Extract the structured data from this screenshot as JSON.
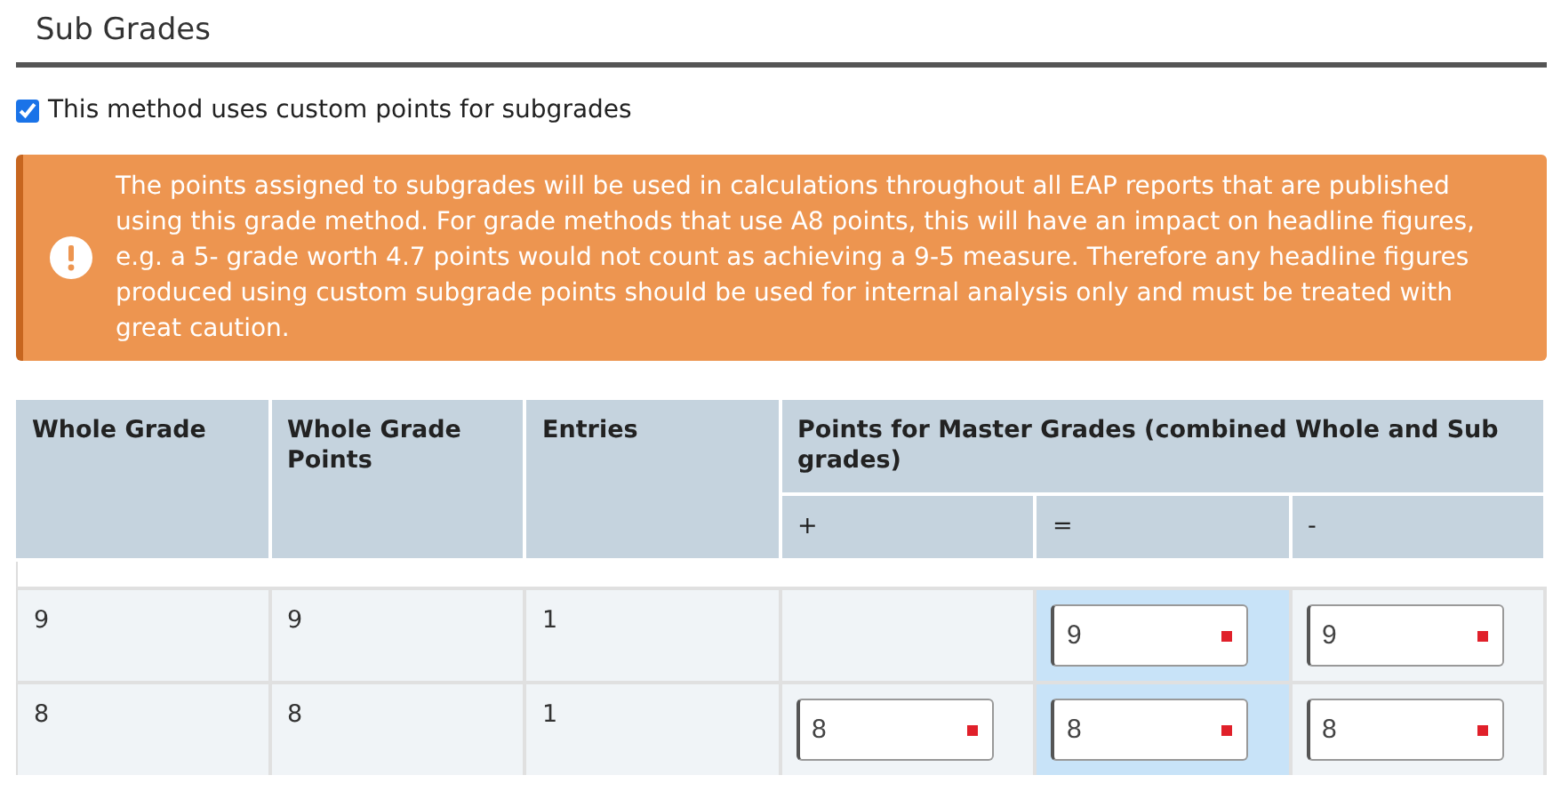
{
  "section": {
    "title": "Sub Grades"
  },
  "custom_points": {
    "label": "This method uses custom points for subgrades",
    "checked": true
  },
  "warning": {
    "text": "The points assigned to subgrades will be used in calculations throughout all EAP reports that are published using this grade method. For grade methods that use A8 points, this will have an impact on headline figures, e.g. a 5- grade worth 4.7 points would not count as achieving a 9-5 measure. Therefore any headline figures produced using custom subgrade points should be used for internal analysis only and must be treated with great caution."
  },
  "table": {
    "columns": [
      "Whole Grade",
      "Whole Grade Points",
      "Entries"
    ],
    "group_heading": "Points for Master Grades (combined Whole and Sub grades)",
    "sub_columns": [
      {
        "label": "+",
        "highlighted": false
      },
      {
        "label": "=",
        "highlighted": true
      },
      {
        "label": "-",
        "highlighted": false
      }
    ],
    "rows": [
      {
        "cells": [
          "9",
          "9",
          "1"
        ],
        "points": [
          {
            "kind": "empty"
          },
          {
            "kind": "input",
            "value": "9",
            "required": true
          },
          {
            "kind": "input",
            "value": "9",
            "required": true
          }
        ]
      },
      {
        "cells": [
          "8",
          "8",
          "1"
        ],
        "points": [
          {
            "kind": "input",
            "value": "8",
            "required": true
          },
          {
            "kind": "input",
            "value": "8",
            "required": true
          },
          {
            "kind": "input",
            "value": "8",
            "required": true
          }
        ]
      }
    ]
  }
}
